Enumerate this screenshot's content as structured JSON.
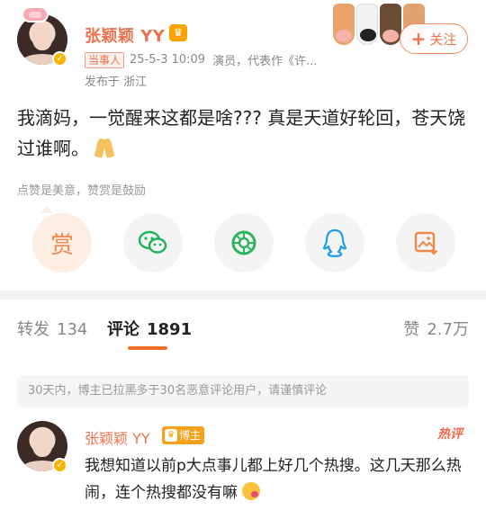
{
  "post": {
    "author": {
      "name": "张颖颖 YY",
      "badge_label": "当事人",
      "timestamp": "25-5-3 10:09",
      "description": "演员，代表作《许...",
      "location": "发布于 浙江"
    },
    "follow_label": "关注",
    "text": "我滴妈，一觉醒来这都是啥???  真是天道好轮回，苍天饶过谁啊。",
    "reward_hint": "点赞是美意，赞赏是鼓励",
    "reward_label": "赏"
  },
  "share_icons": [
    "reward-icon",
    "wechat-icon",
    "moments-icon",
    "qq-icon",
    "save-image-icon"
  ],
  "tabs": {
    "repost": {
      "label": "转发",
      "count": "134"
    },
    "comment": {
      "label": "评论",
      "count": "1891"
    },
    "like": {
      "label": "赞",
      "count": "2.7万"
    }
  },
  "notice": "30天内，博主已拉黑多于30名恶意评论用户，请谨慎评论",
  "comment": {
    "user": "张颖颖 YY",
    "host_label": "博主",
    "hot_label": "热评",
    "text": "我想知道以前p大点事儿都上好几个热搜。这几天那么热闹，连个热搜都没有嘛"
  },
  "colors": {
    "accent": "#eb7350",
    "divider": "#f2f2f2",
    "tab_underline": "#f36f2c"
  }
}
